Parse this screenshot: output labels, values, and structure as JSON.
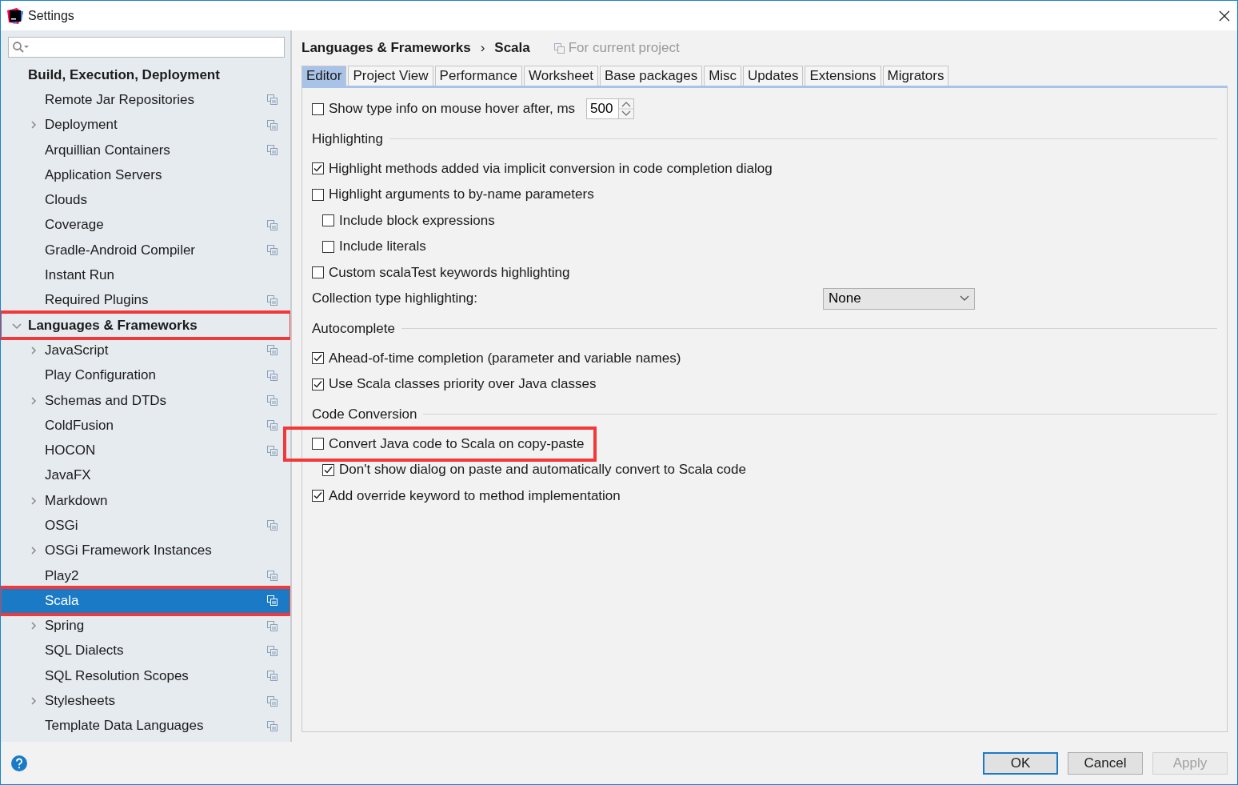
{
  "window": {
    "title": "Settings"
  },
  "sidebar": {
    "items": [
      {
        "label": "Build, Execution, Deployment",
        "kind": "group",
        "annotated": false,
        "children": [
          {
            "label": "Remote Jar Repositories",
            "project_scoped": true,
            "selected": false
          },
          {
            "label": "Deployment",
            "expanded": false,
            "project_scoped": true,
            "selected": false
          },
          {
            "label": "Arquillian Containers",
            "project_scoped": true,
            "selected": false
          },
          {
            "label": "Application Servers",
            "project_scoped": false,
            "selected": false
          },
          {
            "label": "Clouds",
            "project_scoped": false,
            "selected": false
          },
          {
            "label": "Coverage",
            "project_scoped": true,
            "selected": false
          },
          {
            "label": "Gradle-Android Compiler",
            "project_scoped": true,
            "selected": false
          },
          {
            "label": "Instant Run",
            "project_scoped": false,
            "selected": false
          },
          {
            "label": "Required Plugins",
            "project_scoped": true,
            "selected": false
          }
        ]
      },
      {
        "label": "Languages & Frameworks",
        "kind": "group",
        "expanded": true,
        "annotated": true,
        "children": [
          {
            "label": "JavaScript",
            "expanded": false,
            "project_scoped": true,
            "selected": false
          },
          {
            "label": "Play Configuration",
            "project_scoped": true,
            "selected": false
          },
          {
            "label": "Schemas and DTDs",
            "expanded": false,
            "project_scoped": true,
            "selected": false
          },
          {
            "label": "ColdFusion",
            "project_scoped": true,
            "selected": false
          },
          {
            "label": "HOCON",
            "project_scoped": true,
            "selected": false
          },
          {
            "label": "JavaFX",
            "project_scoped": false,
            "selected": false
          },
          {
            "label": "Markdown",
            "expanded": false,
            "project_scoped": false,
            "selected": false
          },
          {
            "label": "OSGi",
            "project_scoped": true,
            "selected": false
          },
          {
            "label": "OSGi Framework Instances",
            "expanded": false,
            "project_scoped": false,
            "selected": false
          },
          {
            "label": "Play2",
            "project_scoped": true,
            "selected": false
          },
          {
            "label": "Scala",
            "project_scoped": true,
            "selected": true,
            "annotated": true
          },
          {
            "label": "Spring",
            "expanded": false,
            "project_scoped": true,
            "selected": false
          },
          {
            "label": "SQL Dialects",
            "project_scoped": true,
            "selected": false
          },
          {
            "label": "SQL Resolution Scopes",
            "project_scoped": true,
            "selected": false
          },
          {
            "label": "Stylesheets",
            "expanded": false,
            "project_scoped": true,
            "selected": false
          },
          {
            "label": "Template Data Languages",
            "project_scoped": true,
            "selected": false
          }
        ]
      }
    ]
  },
  "breadcrumb": {
    "parent": "Languages & Frameworks",
    "separator": "›",
    "current": "Scala",
    "scope": "For current project"
  },
  "tabs": [
    {
      "label": "Editor",
      "selected": true
    },
    {
      "label": "Project View",
      "selected": false
    },
    {
      "label": "Performance",
      "selected": false
    },
    {
      "label": "Worksheet",
      "selected": false
    },
    {
      "label": "Base packages",
      "selected": false
    },
    {
      "label": "Misc",
      "selected": false
    },
    {
      "label": "Updates",
      "selected": false
    },
    {
      "label": "Extensions",
      "selected": false
    },
    {
      "label": "Migrators",
      "selected": false
    }
  ],
  "options": [
    {
      "kind": "checkbox",
      "label": "Show type info on mouse hover after, ms",
      "checked": false,
      "spinner": "500"
    },
    {
      "kind": "section",
      "label": "Highlighting"
    },
    {
      "kind": "checkbox",
      "label": "Highlight methods added via implicit conversion in code completion dialog",
      "checked": true
    },
    {
      "kind": "checkbox",
      "label": "Highlight arguments to by-name parameters",
      "checked": false,
      "children": [
        {
          "kind": "checkbox",
          "label": "Include block expressions",
          "checked": false
        },
        {
          "kind": "checkbox",
          "label": "Include literals",
          "checked": false
        }
      ]
    },
    {
      "kind": "checkbox",
      "label": "Custom scalaTest keywords highlighting",
      "checked": false
    },
    {
      "kind": "dropdown",
      "label": "Collection type highlighting:",
      "value": "None"
    },
    {
      "kind": "section",
      "label": "Autocomplete"
    },
    {
      "kind": "checkbox",
      "label": "Ahead-of-time completion (parameter and variable names)",
      "checked": true
    },
    {
      "kind": "checkbox",
      "label": "Use Scala classes priority over Java classes",
      "checked": true
    },
    {
      "kind": "section",
      "label": "Code Conversion"
    },
    {
      "kind": "checkbox",
      "label": "Convert Java code to Scala on copy-paste",
      "checked": false,
      "annotated": true,
      "children": [
        {
          "kind": "checkbox",
          "label": "Don't show dialog on paste and automatically convert to Scala code",
          "checked": true
        }
      ]
    },
    {
      "kind": "checkbox",
      "label": "Add override keyword to method implementation",
      "checked": true
    }
  ],
  "buttons": [
    {
      "label": "OK",
      "kind": "default",
      "disabled": false
    },
    {
      "label": "Cancel",
      "kind": "normal",
      "disabled": false
    },
    {
      "label": "Apply",
      "kind": "normal",
      "disabled": true
    }
  ]
}
